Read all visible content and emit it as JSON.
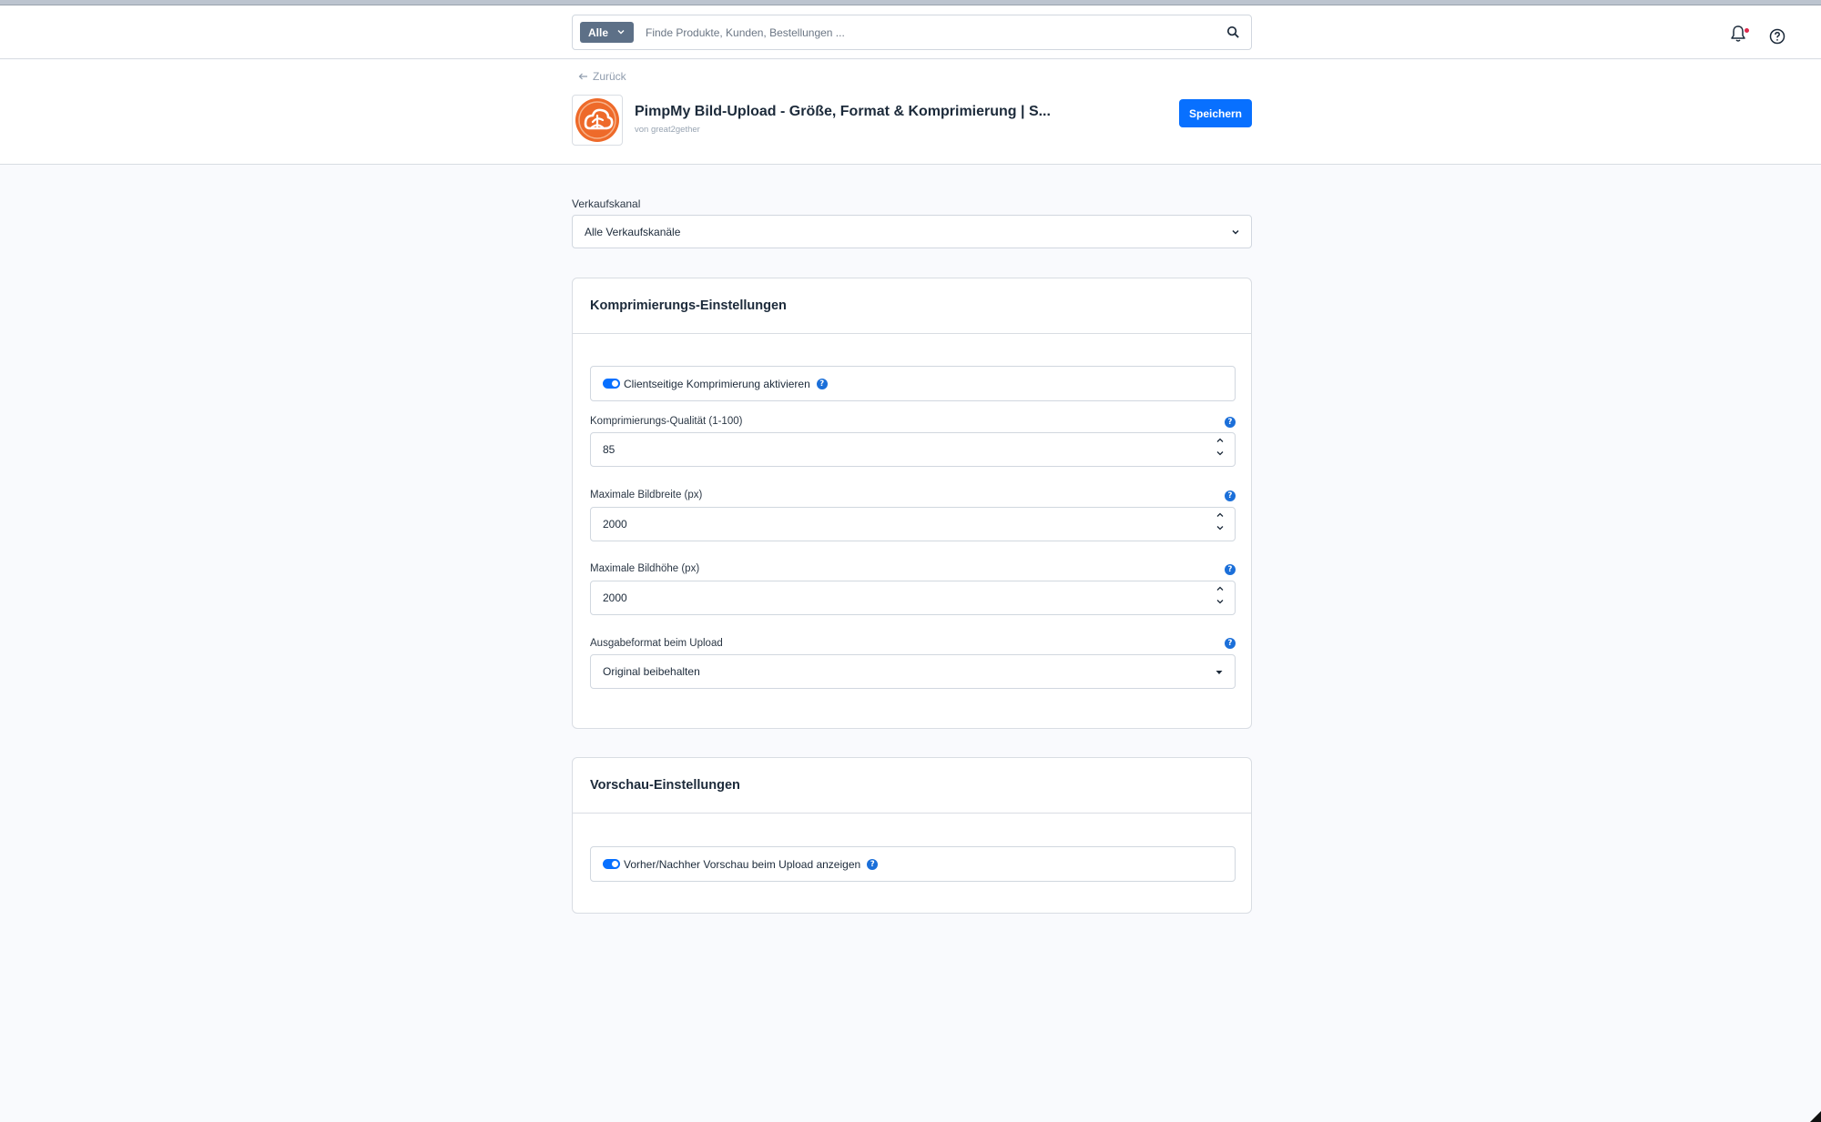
{
  "topbar": {
    "search_type": "Alle",
    "search_placeholder": "Finde Produkte, Kunden, Bestellungen ..."
  },
  "header": {
    "back_label": "Zurück",
    "title": "PimpMy Bild-Upload - Größe, Format & Komprimierung | S...",
    "vendor": "von great2gether",
    "save_label": "Speichern"
  },
  "sales_channel": {
    "label": "Verkaufskanal",
    "value": "Alle Verkaufskanäle"
  },
  "compression": {
    "title": "Komprimierungs-Einstellungen",
    "toggle_label": "Clientseitige Komprimierung aktivieren",
    "toggle_on": true,
    "quality_label": "Komprimierungs-Qualität (1-100)",
    "quality_value": "85",
    "max_width_label": "Maximale Bildbreite (px)",
    "max_width_value": "2000",
    "max_height_label": "Maximale Bildhöhe (px)",
    "max_height_value": "2000",
    "format_label": "Ausgabeformat beim Upload",
    "format_value": "Original beibehalten"
  },
  "preview": {
    "title": "Vorschau-Einstellungen",
    "toggle_label": "Vorher/Nachher Vorschau beim Upload anzeigen",
    "toggle_on": true
  },
  "colors": {
    "primary": "#0870ff",
    "badge": "#5d7087",
    "notification": "#de294c",
    "logo_orange": "#ee6a2a"
  },
  "icons": [
    "arrow-left-icon",
    "search-icon",
    "bell-icon",
    "help-icon",
    "info-icon",
    "chevron-down-icon",
    "chevron-up-icon",
    "plugin-logo-icon"
  ]
}
